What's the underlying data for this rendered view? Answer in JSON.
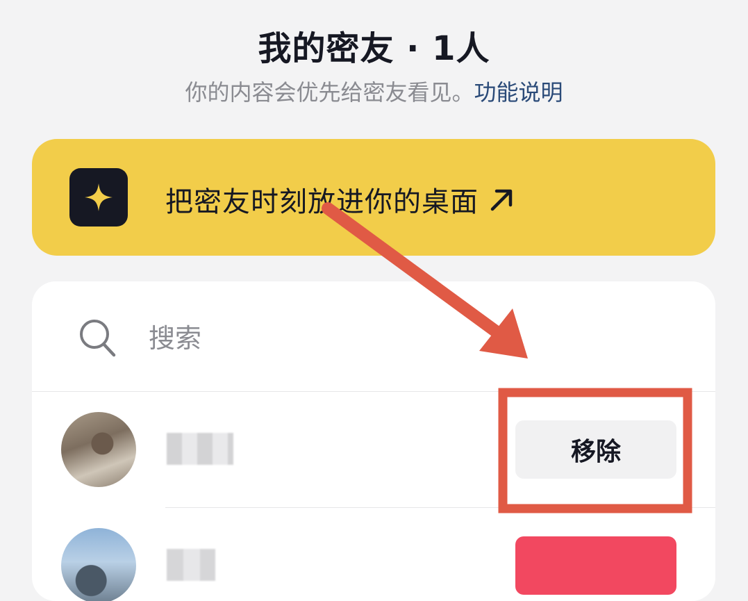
{
  "header": {
    "title": "我的密友 · 1人",
    "subtitle_text": "你的内容会优先给密友看见。",
    "subtitle_link": "功能说明"
  },
  "banner": {
    "icon": "sparkle-icon",
    "text": "把密友时刻放进你的桌面",
    "arrow_icon": "arrow-up-right-icon",
    "background": "#f2cd4a"
  },
  "search": {
    "icon": "search-icon",
    "placeholder": "搜索",
    "value": ""
  },
  "friends": [
    {
      "avatar": "avatar",
      "name": "",
      "action_label": "移除"
    },
    {
      "avatar": "avatar",
      "name": "",
      "action_label": ""
    }
  ],
  "colors": {
    "accent_red": "#f24860",
    "annotation_red": "#e05a45",
    "link_blue": "#2a4a78"
  }
}
